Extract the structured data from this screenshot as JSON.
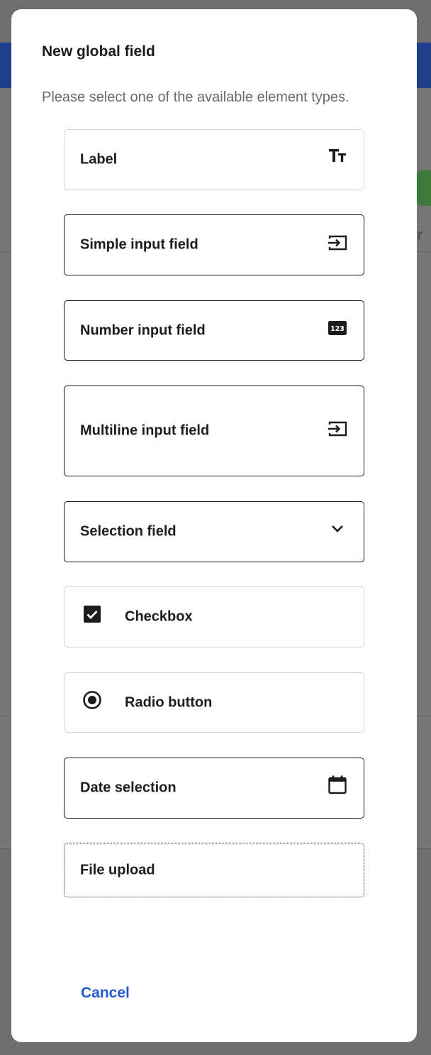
{
  "dialog": {
    "title": "New global field",
    "subtitle": "Please select one of the available element types.",
    "cancel_label": "Cancel"
  },
  "options": [
    {
      "label": "Label",
      "icon": "text-size-icon"
    },
    {
      "label": "Simple input field",
      "icon": "input-icon"
    },
    {
      "label": "Number input field",
      "icon": "number-123-icon"
    },
    {
      "label": "Multiline input field",
      "icon": "input-icon"
    },
    {
      "label": "Selection field",
      "icon": "chevron-down-icon"
    },
    {
      "label": "Checkbox",
      "icon": "checkbox-checked-icon"
    },
    {
      "label": "Radio button",
      "icon": "radio-checked-icon"
    },
    {
      "label": "Date selection",
      "icon": "calendar-icon"
    },
    {
      "label": "File upload",
      "icon": ""
    }
  ],
  "colors": {
    "accent": "#2557d6",
    "text": "#1c1c1c",
    "muted": "#6a6a6a",
    "border_light": "#d4d4d4"
  }
}
